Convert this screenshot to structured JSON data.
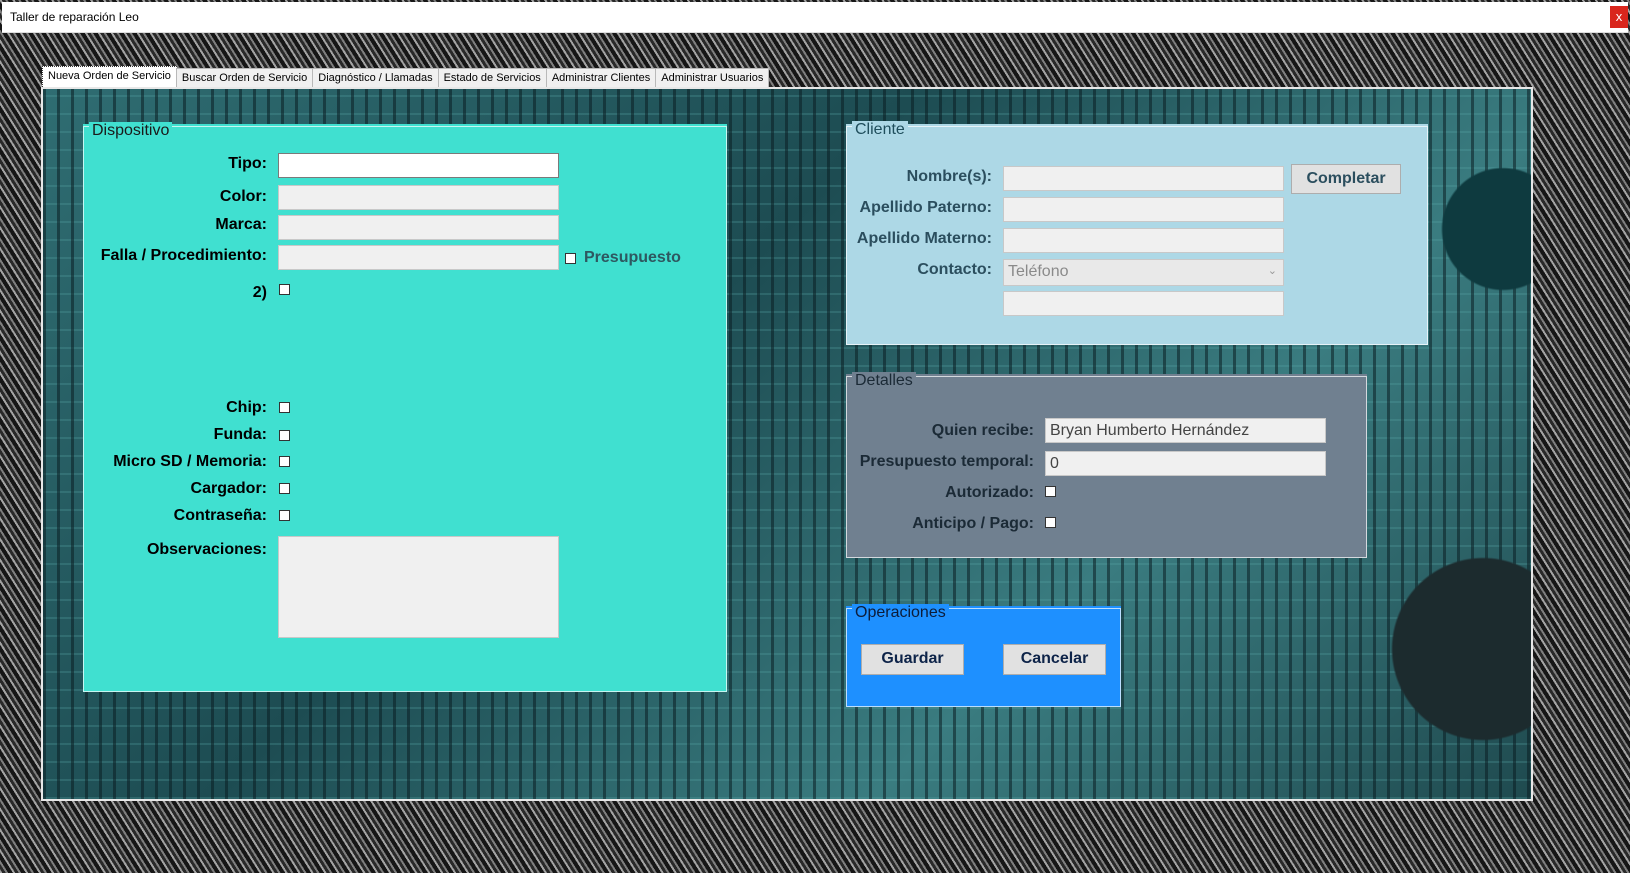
{
  "window": {
    "title": "Taller de reparación Leo",
    "close_label": "x"
  },
  "tabs": [
    {
      "label": "Nueva Orden de Servicio"
    },
    {
      "label": "Buscar Orden de Servicio"
    },
    {
      "label": "Diagnóstico / Llamadas"
    },
    {
      "label": "Estado de Servicios"
    },
    {
      "label": "Administrar Clientes"
    },
    {
      "label": "Administrar Usuarios"
    }
  ],
  "dispositivo": {
    "title": "Dispositivo",
    "tipo_label": "Tipo:",
    "tipo_value": "",
    "color_label": "Color:",
    "color_value": "",
    "marca_label": "Marca:",
    "marca_value": "",
    "falla_label": "Falla / Procedimiento:",
    "falla_value": "",
    "presupuesto_label": "Presupuesto",
    "two_label": "2)",
    "chip_label": "Chip:",
    "funda_label": "Funda:",
    "microsd_label": "Micro SD / Memoria:",
    "cargador_label": "Cargador:",
    "contrasena_label": "Contraseña:",
    "observaciones_label": "Observaciones:",
    "observaciones_value": ""
  },
  "cliente": {
    "title": "Cliente",
    "nombre_label": "Nombre(s):",
    "nombre_value": "",
    "completar_label": "Completar",
    "apellido_paterno_label": "Apellido Paterno:",
    "apellido_paterno_value": "",
    "apellido_materno_label": "Apellido Materno:",
    "apellido_materno_value": "",
    "contacto_label": "Contacto:",
    "contacto_selected": "Teléfono",
    "contacto_value": ""
  },
  "detalles": {
    "title": "Detalles",
    "quien_recibe_label": "Quien recibe:",
    "quien_recibe_value": "Bryan Humberto Hernández",
    "presupuesto_temporal_label": "Presupuesto temporal:",
    "presupuesto_temporal_value": "0",
    "autorizado_label": "Autorizado:",
    "anticipo_label": "Anticipo / Pago:"
  },
  "operaciones": {
    "title": "Operaciones",
    "guardar_label": "Guardar",
    "cancelar_label": "Cancelar"
  },
  "colors": {
    "dispositivo_bg": "#40e0d0",
    "cliente_bg": "#add8e6",
    "detalles_bg": "#708090",
    "operaciones_bg": "#1e90ff"
  }
}
